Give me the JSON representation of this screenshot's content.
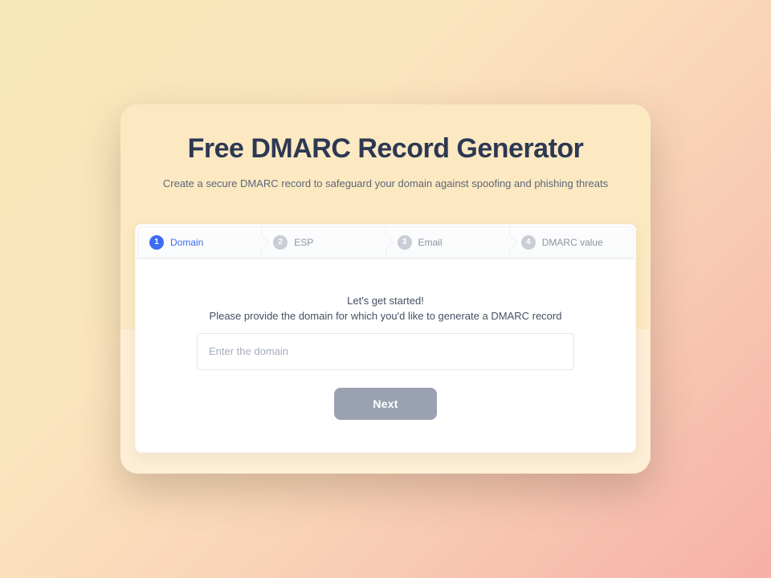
{
  "header": {
    "title": "Free DMARC Record Generator",
    "subtitle": "Create a secure DMARC record to safeguard your domain against spoofing and phishing threats"
  },
  "steps": [
    {
      "num": "1",
      "label": "Domain",
      "active": true
    },
    {
      "num": "2",
      "label": "ESP",
      "active": false
    },
    {
      "num": "3",
      "label": "Email",
      "active": false
    },
    {
      "num": "4",
      "label": "DMARC value",
      "active": false
    }
  ],
  "body": {
    "lead": "Let's get started!",
    "desc": "Please provide the domain for which you'd like to generate a DMARC record",
    "domain_placeholder": "Enter the domain",
    "domain_value": "",
    "next_label": "Next"
  }
}
